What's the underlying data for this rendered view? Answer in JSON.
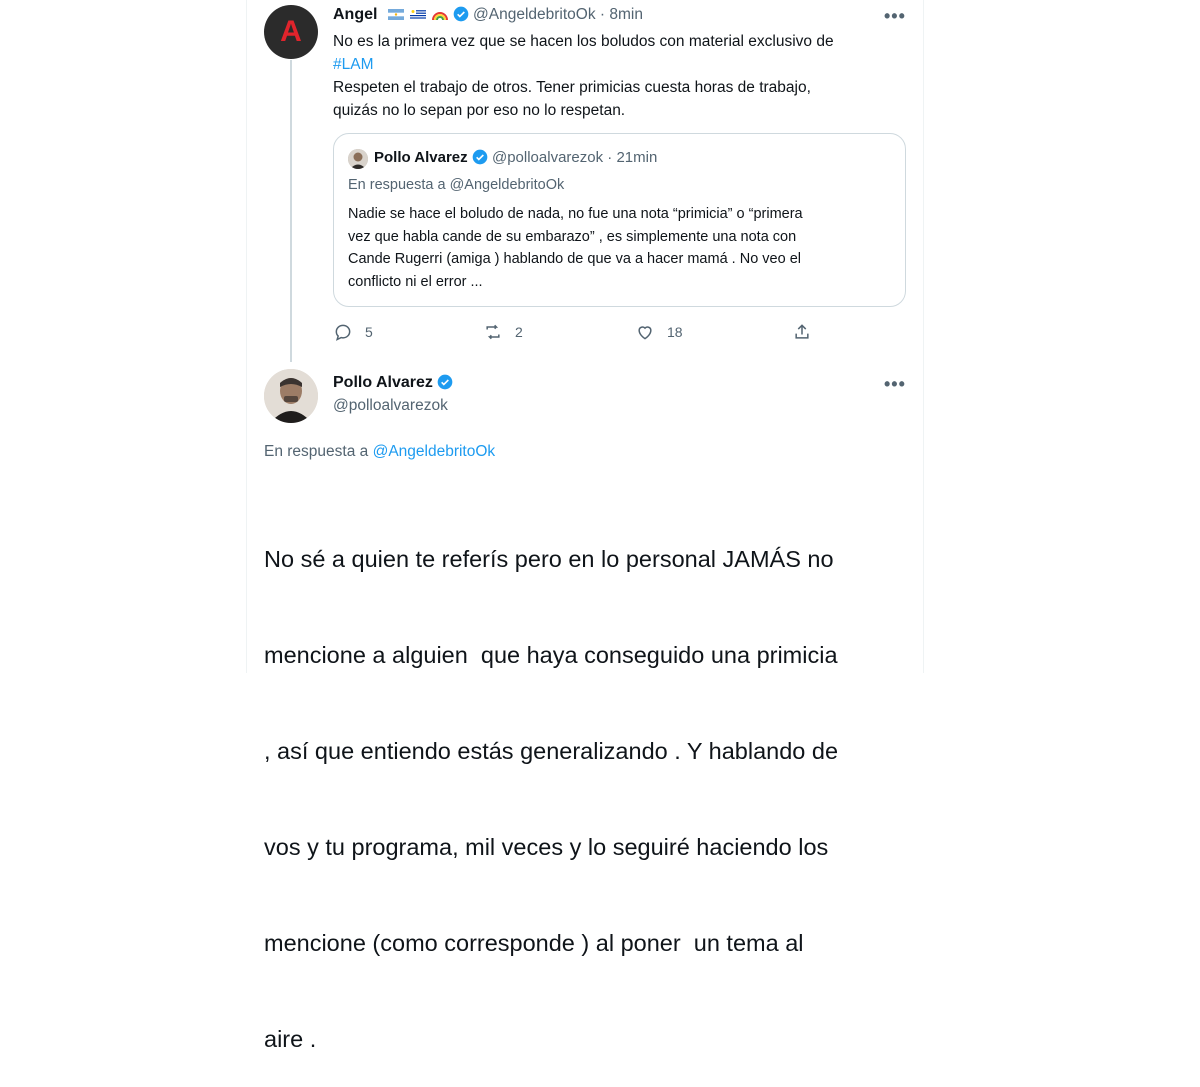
{
  "tweet1": {
    "avatar_letter": "A",
    "name": "Angel",
    "handle": "@AngeldebritoOk",
    "sep": "·",
    "time": "8min",
    "more": "•••",
    "line1": "No es la primera vez que se hacen los boludos con material exclusivo de",
    "hashtag": "#LAM",
    "line3": "Respeten el trabajo de otros. Tener primicias cuesta horas de trabajo,",
    "line4": "quizás no lo sepan por eso no lo respetan.",
    "actions": {
      "replies": "5",
      "retweets": "2",
      "likes": "18"
    }
  },
  "quoted": {
    "name": "Pollo Alvarez",
    "handle": "@polloalvarezok",
    "sep": "·",
    "time": "21min",
    "reply_prefix": "En respuesta a",
    "reply_to": "@AngeldebritoOk",
    "lines": [
      "Nadie se hace el boludo de nada, no fue una nota “primicia” o “primera",
      "vez que habla cande de su embarazo” , es simplemente una nota con",
      "Cande Rugerri (amiga ) hablando de que va a hacer mamá . No veo el",
      "conflicto ni el error ..."
    ]
  },
  "tweet2": {
    "name": "Pollo Alvarez",
    "handle": "@polloalvarezok",
    "more": "•••",
    "reply_prefix": "En respuesta a",
    "reply_to": "@AngeldebritoOk",
    "lines": [
      "No sé a quien te referís pero en lo personal JAMÁS no",
      "mencione a alguien  que haya conseguido una primicia",
      ", así que entiendo estás generalizando . Y hablando de",
      "vos y tu programa, mil veces y lo seguiré haciendo los",
      "mencione (como corresponde ) al poner  un tema al",
      "aire ."
    ]
  },
  "colors": {
    "accent": "#1d9bf0",
    "muted": "#536471",
    "avatar_angel_bg": "#2b2b2b",
    "avatar_angel_letter": "#e0242c"
  }
}
